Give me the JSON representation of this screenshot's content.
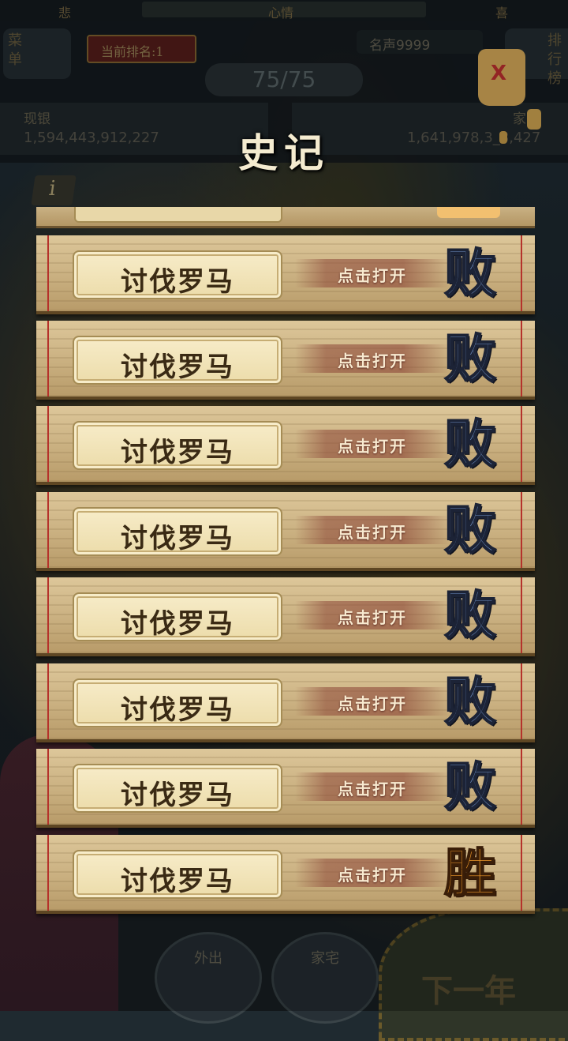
{
  "hud": {
    "mood_left": "悲",
    "mood_center": "心情",
    "mood_right": "喜",
    "menu_label": "菜单",
    "rank_label": "当前排名:1",
    "fame": "名声9999",
    "turn": "75/75",
    "silver_label": "现银",
    "silver_value": "1,594,443,912,227",
    "other_label": "家",
    "other_value": "1,641,978,3_8,427",
    "leaderboard_label": "排行榜",
    "info_symbol": "i",
    "lantern_mark": "X"
  },
  "bottom": {
    "outing": "外出",
    "home": "家宅",
    "next_year": "下一年"
  },
  "dialog": {
    "title": "史记",
    "records": [
      {
        "name": "讨伐罗马",
        "action": "点击打开",
        "result": "败",
        "outcome": "lose"
      },
      {
        "name": "讨伐罗马",
        "action": "点击打开",
        "result": "败",
        "outcome": "lose"
      },
      {
        "name": "讨伐罗马",
        "action": "点击打开",
        "result": "败",
        "outcome": "lose"
      },
      {
        "name": "讨伐罗马",
        "action": "点击打开",
        "result": "败",
        "outcome": "lose"
      },
      {
        "name": "讨伐罗马",
        "action": "点击打开",
        "result": "败",
        "outcome": "lose"
      },
      {
        "name": "讨伐罗马",
        "action": "点击打开",
        "result": "败",
        "outcome": "lose"
      },
      {
        "name": "讨伐罗马",
        "action": "点击打开",
        "result": "败",
        "outcome": "lose"
      },
      {
        "name": "讨伐罗马",
        "action": "点击打开",
        "result": "胜",
        "outcome": "win"
      }
    ]
  }
}
